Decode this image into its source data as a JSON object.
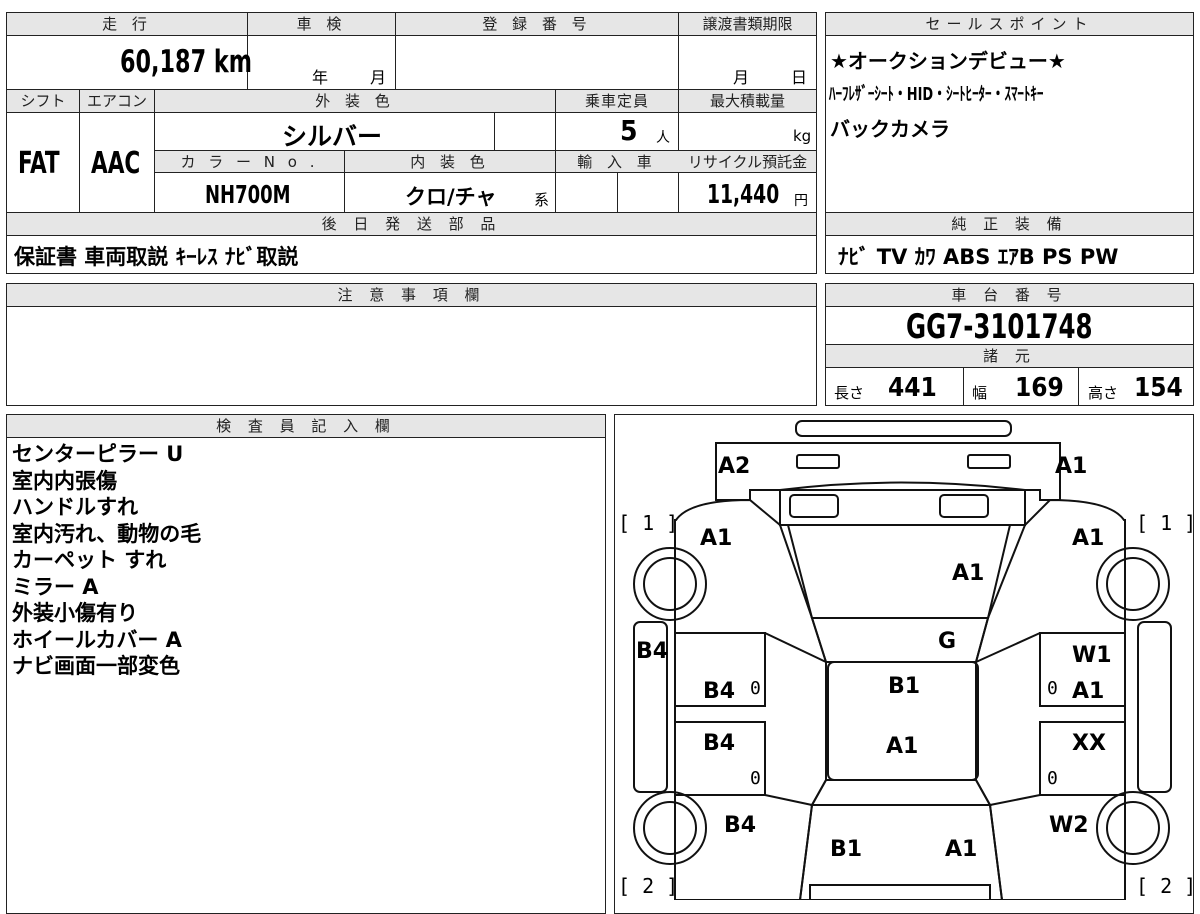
{
  "basic": {
    "mileage_label": "走 行",
    "mileage": "60,187 km",
    "inspection_label": "車 検",
    "inspection_year": "年",
    "inspection_month": "月",
    "registration_label": "登 録 番 号",
    "transfer_label": "譲渡書類期限",
    "transfer_month": "月",
    "transfer_day": "日",
    "shift_label": "シフト",
    "shift": "FAT",
    "ac_label": "エアコン",
    "ac": "AAC",
    "exterior_color_label": "外 装 色",
    "exterior_color": "シルバー",
    "capacity_label": "乗車定員",
    "capacity": "5",
    "capacity_unit": "人",
    "max_load_label": "最大積載量",
    "max_load_unit": "kg",
    "color_no_label": "カ ラ ー N o .",
    "color_no": "NH700M",
    "interior_color_label": "内 装 色",
    "interior_color": "クロ/チャ",
    "interior_suffix": "系",
    "import_label": "輸 入 車",
    "recycle_label": "リサイクル預託金",
    "recycle_fee": "11,440",
    "recycle_unit": "円"
  },
  "later_parts": {
    "label": "後 日 発 送 部 品",
    "value": "保証書 車両取説 ｷｰﾚｽ ﾅﾋﾞ取説"
  },
  "caution": {
    "label": "注 意 事 項 欄"
  },
  "sales_points": {
    "label": "セールスポイント",
    "lines": [
      "★オークションデビュー★",
      "ﾊｰﾌﾚｻﾞｰｼｰﾄ・HID・ｼｰﾄﾋｰﾀｰ・ｽﾏｰﾄｷｰ",
      "バックカメラ"
    ]
  },
  "equipment": {
    "label": "純 正 装 備",
    "value": "ﾅﾋﾞ TV ｶﾜ ABS ｴｱB PS PW"
  },
  "chassis": {
    "label": "車 台 番 号",
    "number": "GG7-3101748"
  },
  "specs": {
    "label": "諸 元",
    "length_label": "長さ",
    "length": "441",
    "width_label": "幅",
    "width": "169",
    "height_label": "高さ",
    "height": "154"
  },
  "inspector": {
    "label": "検 査 員 記 入 欄",
    "notes": [
      "センターピラー U",
      "室内内張傷",
      "ハンドルすれ",
      "室内汚れ、動物の毛",
      "カーペット すれ",
      "ミラー A",
      "外装小傷有り",
      "ホイールカバー A",
      "ナビ画面一部変色"
    ]
  },
  "diagram": {
    "marks": {
      "rear_left": "A2",
      "rear_right": "A1",
      "left_corner_rear": "A1",
      "right_corner_rear": "A1",
      "trunk": "A1",
      "rear_glass": "G",
      "left_bpillar_outer": "B4",
      "left_door_rear": "B4",
      "right_door_rear_w": "W1",
      "right_door_rear_a": "A1",
      "roof": "B1",
      "roof2": "A1",
      "left_door_front": "B4",
      "right_door_front": "XX",
      "left_fender": "B4",
      "right_fender": "W2",
      "hood_left": "B1",
      "hood_right": "A1"
    },
    "zero_marks": [
      "0",
      "0",
      "0",
      "0"
    ],
    "tire_rear_left": "[ 1 ]",
    "tire_rear_right": "[ 1 ]",
    "tire_front_left": "[ 2 ]",
    "tire_front_right": "[ 2 ]"
  }
}
